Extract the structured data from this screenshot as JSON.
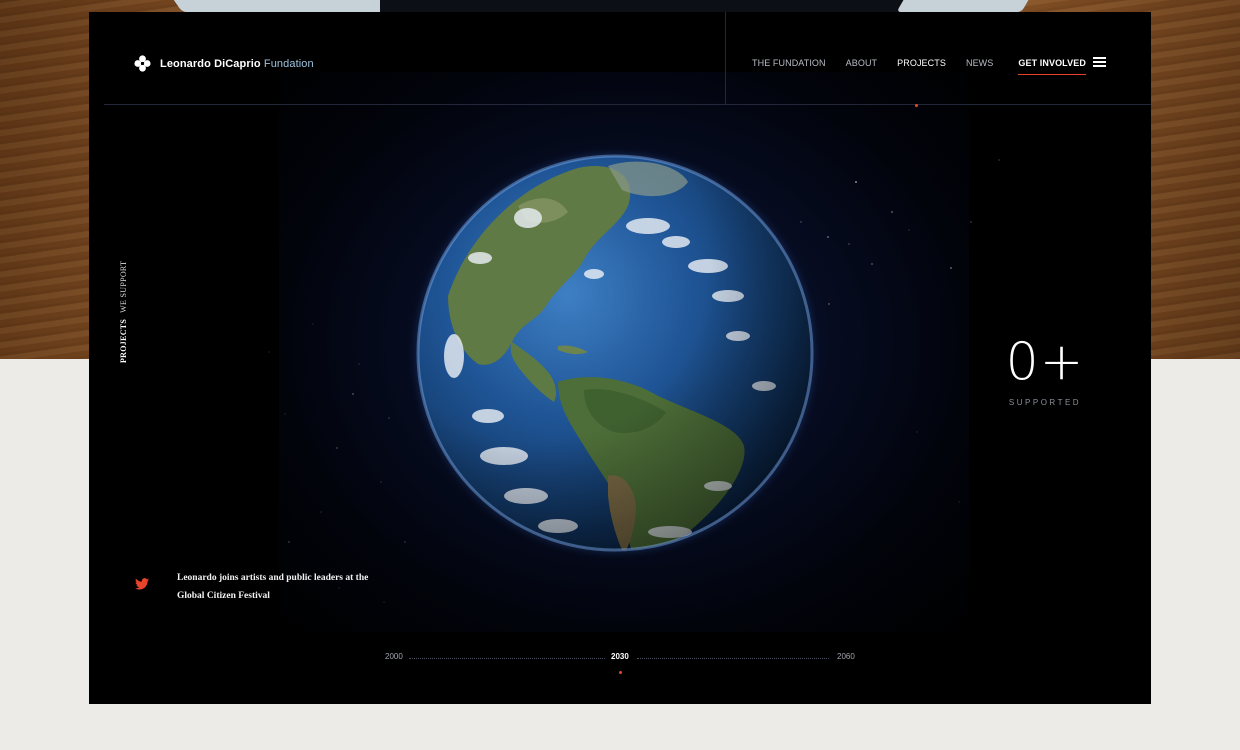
{
  "brand": {
    "name": "Leonardo DiCaprio",
    "accent": "Fundation"
  },
  "nav": {
    "items": [
      {
        "label": "THE FUNDATION"
      },
      {
        "label": "ABOUT"
      },
      {
        "label": "PROJECTS"
      },
      {
        "label": "NEWS"
      }
    ],
    "cta": "GET INVOLVED",
    "active": "PROJECTS"
  },
  "section": {
    "label_strong": "PROJECTS",
    "label_rest": "WE SUPPORT"
  },
  "counter": {
    "value": "0+",
    "label": "SUPPORTED"
  },
  "tweet": {
    "text": "Leonardo joins artists and public leaders at the Global Citizen Festival"
  },
  "timeline": {
    "start": "2000",
    "current": "2030",
    "end": "2060"
  },
  "colors": {
    "accent_red": "#e8432b",
    "brand_accent_blue": "#9fc3de",
    "background": "#000000"
  },
  "icons": {
    "logo": "clover-logo-icon",
    "menu": "hamburger-menu-icon",
    "social": "twitter-icon"
  }
}
